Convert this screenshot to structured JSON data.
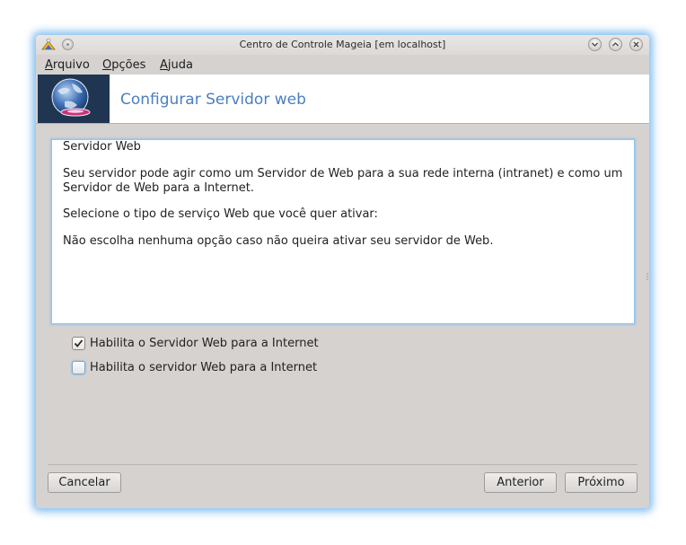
{
  "window": {
    "title": "Centro de Controle Mageia  [em localhost]"
  },
  "menu": {
    "items": [
      {
        "mnemonic": "A",
        "rest": "rquivo"
      },
      {
        "mnemonic": "O",
        "rest": "pções"
      },
      {
        "mnemonic": "A",
        "rest": "juda"
      }
    ]
  },
  "banner": {
    "title": "Configurar Servidor web"
  },
  "description": {
    "lines": [
      "Servidor Web",
      "Seu servidor pode agir como um Servidor de Web para a sua rede interna (intranet) e como um",
      "Servidor de Web para a Internet.",
      "Selecione o tipo de serviço Web que você quer ativar:",
      "Não escolha nenhuma opção caso não queira ativar seu servidor de Web."
    ]
  },
  "options": [
    {
      "label": "Habilita o Servidor Web para a Internet",
      "checked": true
    },
    {
      "label": "Habilita o servidor Web para a Internet",
      "checked": false
    }
  ],
  "buttons": {
    "cancel": "Cancelar",
    "previous": "Anterior",
    "next": "Próximo"
  },
  "colors": {
    "accent": "#4a7fc0",
    "focus_glow": "#5aaaeb",
    "window_bg": "#d6d2d0"
  },
  "icons": {
    "app": "mageia-control-center-icon",
    "banner": "globe-webserver-icon"
  }
}
